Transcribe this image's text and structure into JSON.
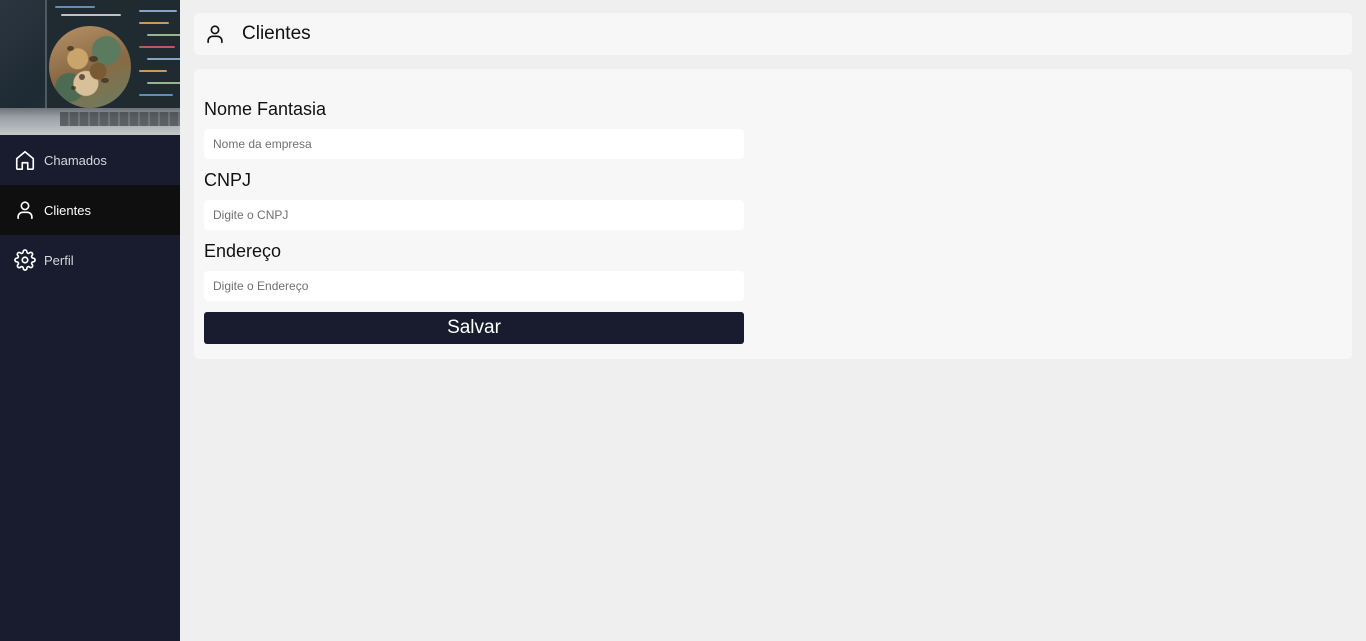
{
  "sidebar": {
    "items": [
      {
        "label": "Chamados",
        "icon": "home-icon",
        "active": false
      },
      {
        "label": "Clientes",
        "icon": "user-icon",
        "active": true
      },
      {
        "label": "Perfil",
        "icon": "gear-icon",
        "active": false
      }
    ]
  },
  "header": {
    "title": "Clientes",
    "icon": "user-icon"
  },
  "form": {
    "fields": [
      {
        "label": "Nome Fantasia",
        "placeholder": "Nome da empresa",
        "value": ""
      },
      {
        "label": "CNPJ",
        "placeholder": "Digite o CNPJ",
        "value": ""
      },
      {
        "label": "Endereço",
        "placeholder": "Digite o Endereço",
        "value": ""
      }
    ],
    "submit_label": "Salvar"
  },
  "colors": {
    "sidebar_bg": "#181c2e",
    "active_item_bg": "#0f0f10",
    "page_bg": "#efefef",
    "panel_bg": "#f7f7f7",
    "button_bg": "#181c2e"
  }
}
